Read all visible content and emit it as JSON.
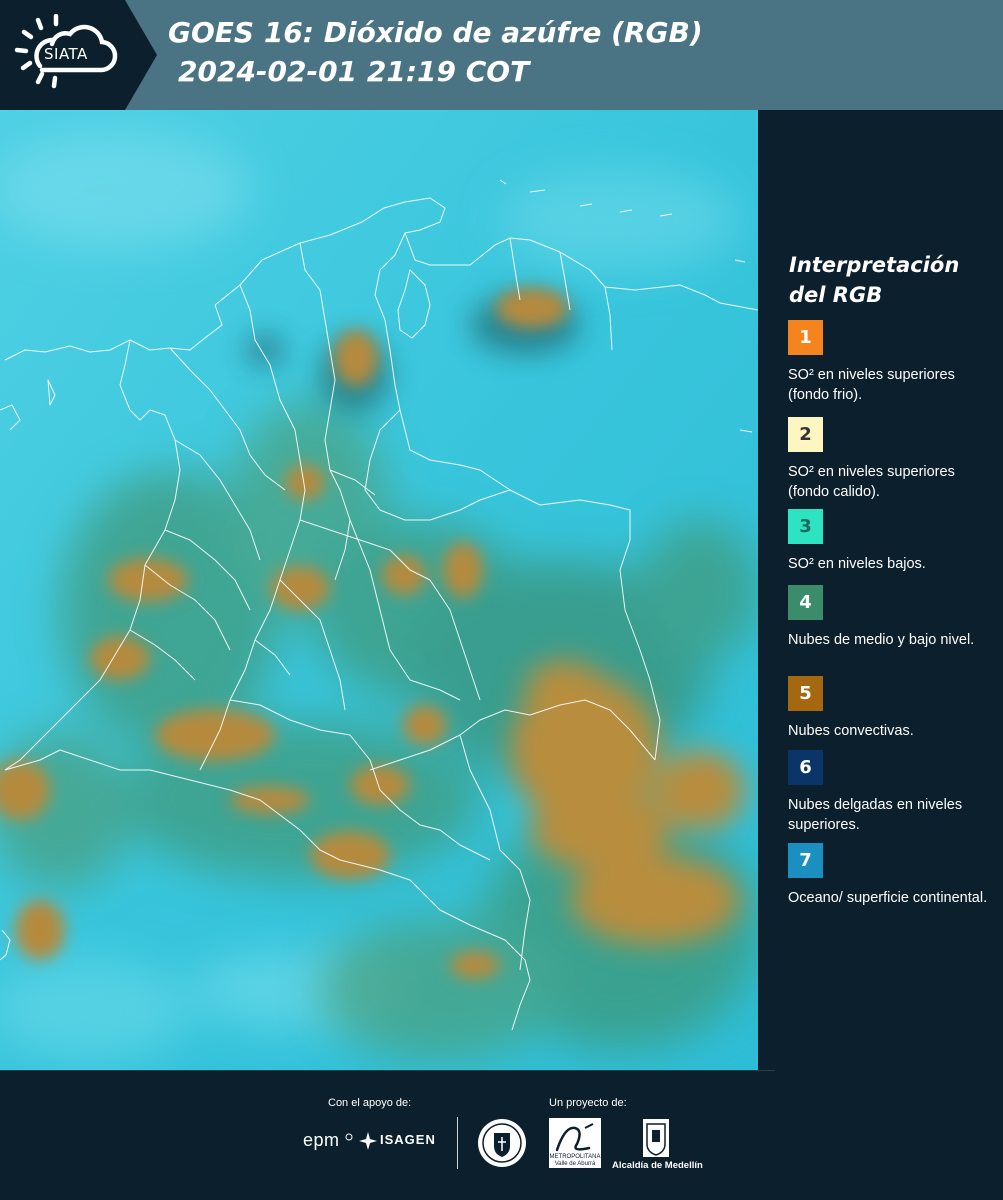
{
  "header": {
    "logo_text": "SIATA",
    "title_line1": "GOES 16: Dióxido de azúfre (RGB)",
    "title_line2": "2024-02-01 21:19 COT"
  },
  "legend": {
    "title_line1": "Interpretación",
    "title_line2": "del RGB",
    "items": [
      {
        "number": "1",
        "color": "#f5841f",
        "text": "SO² en niveles superiores (fondo frio)."
      },
      {
        "number": "2",
        "color": "#fdf6c0",
        "text": "SO² en niveles superiores (fondo calido)."
      },
      {
        "number": "3",
        "color": "#2de3c2",
        "text": "SO² en niveles bajos."
      },
      {
        "number": "4",
        "color": "#3a8c6a",
        "text": "Nubes de medio y bajo nivel."
      },
      {
        "number": "5",
        "color": "#a5670f",
        "text": "Nubes convectivas."
      },
      {
        "number": "6",
        "color": "#0b3569",
        "text": "Nubes delgadas en niveles superiores."
      },
      {
        "number": "7",
        "color": "#1a8fc0",
        "text": "Oceano/ superficie continental."
      }
    ]
  },
  "footer": {
    "support_label": "Con el apoyo de:",
    "project_label": "Un proyecto de:",
    "epm": "epm",
    "isagen": "ISAGEN",
    "area_line1": "METROPOLITANA",
    "area_line2": "Valle de Aburrá",
    "alcaldia": "Alcaldía de Medellín"
  },
  "colors": {
    "header_bg": "#4a7383",
    "panel_bg": "#0c1f2c",
    "map_cyan": "#35c6dd",
    "convective": "#b58a3c",
    "mid_low": "#3f9a7c"
  }
}
